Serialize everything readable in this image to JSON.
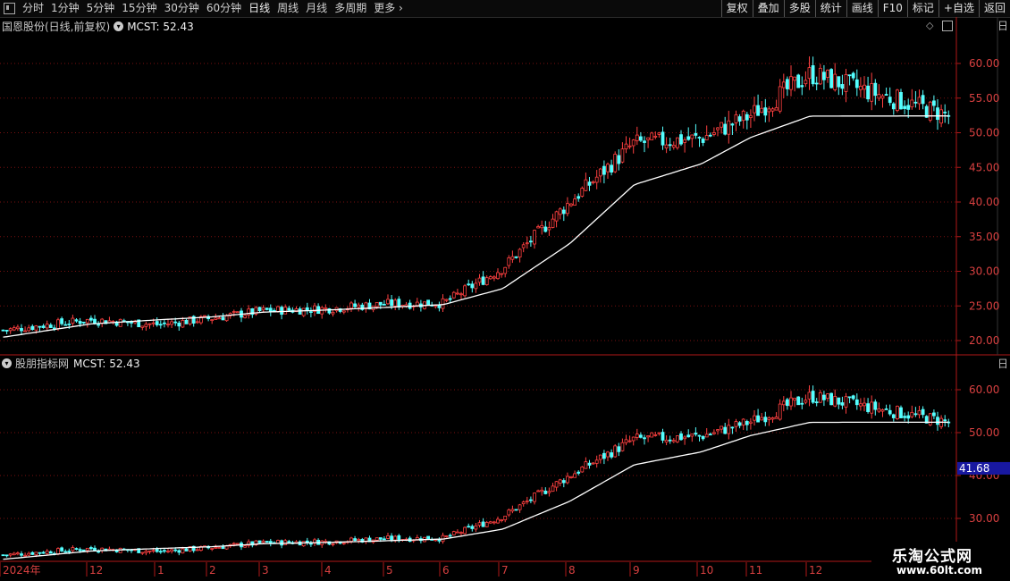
{
  "toolbar": {
    "periods": [
      "分时",
      "1分钟",
      "5分钟",
      "15分钟",
      "30分钟",
      "60分钟",
      "日线",
      "周线",
      "月线",
      "多周期",
      "更多"
    ],
    "active_period": "日线",
    "right_buttons": [
      "复权",
      "叠加",
      "多股",
      "统计",
      "画线",
      "F10",
      "标记",
      "+自选",
      "返回"
    ]
  },
  "main_panel": {
    "stock_title": "国恩股份(日线,前复权)",
    "indicator": "MCST: 52.43",
    "y_ticks": [
      "60.00",
      "55.00",
      "50.00",
      "45.00",
      "40.00",
      "35.00",
      "30.00",
      "25.00",
      "20.00"
    ]
  },
  "sub_panel": {
    "title": "股朋指标网",
    "indicator": "MCST: 52.43",
    "y_ticks": [
      "60.00",
      "50.00",
      "40.00",
      "30.00"
    ],
    "crosshair_value": "41.68"
  },
  "x_axis": {
    "labels": [
      "2024年",
      "12",
      "1",
      "2",
      "3",
      "4",
      "5",
      "6",
      "7",
      "8",
      "9",
      "10",
      "11",
      "12"
    ]
  },
  "watermark": {
    "line1": "乐淘公式网",
    "line2": "www.60lt.com"
  },
  "side_tab": {
    "top_label": "日",
    "sub_label": "日"
  },
  "colors": {
    "up": "#ff4040",
    "down": "#54ffff",
    "mcst_line": "#ffffff",
    "grid": "#7a1010",
    "axis": "#b01818",
    "tick_text": "#d84040",
    "crosshair_bg": "#1818a0"
  },
  "chart_data": {
    "type": "candlestick",
    "series_mcst_last": 52.43,
    "ylim_main": [
      19,
      66
    ],
    "ylim_sub": [
      27,
      67
    ],
    "months": [
      "2024年",
      "12",
      "1",
      "2",
      "3",
      "4",
      "5",
      "6",
      "7",
      "8",
      "9",
      "10",
      "11",
      "12"
    ],
    "close_by_month": [
      21.5,
      23.0,
      22.3,
      23.2,
      24.3,
      24.6,
      25.3,
      25.4,
      30.5,
      40.0,
      48.5,
      49.2,
      52.5,
      58.5
    ],
    "mcst_by_month": [
      20.5,
      22.4,
      23.0,
      23.4,
      24.1,
      24.4,
      24.8,
      25.2,
      27.5,
      34.0,
      42.5,
      45.5,
      49.3,
      52.4
    ]
  }
}
